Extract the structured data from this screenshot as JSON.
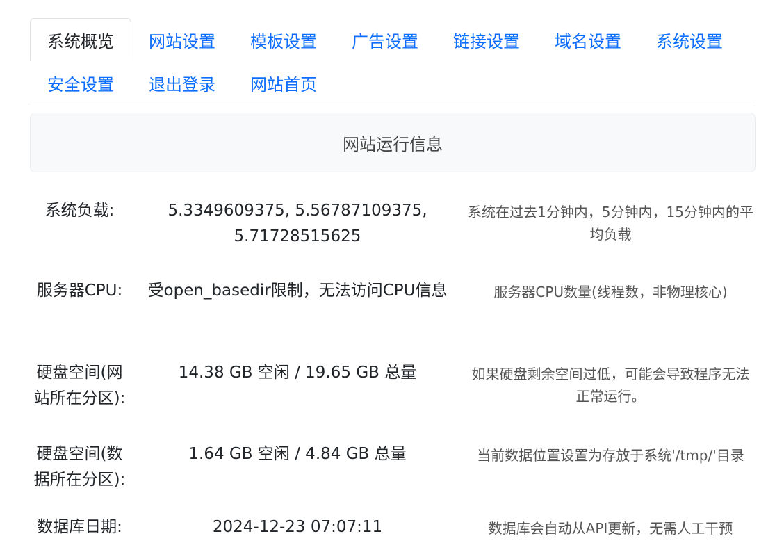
{
  "tabs": [
    {
      "label": "系统概览",
      "active": true
    },
    {
      "label": "网站设置",
      "active": false
    },
    {
      "label": "模板设置",
      "active": false
    },
    {
      "label": "广告设置",
      "active": false
    },
    {
      "label": "链接设置",
      "active": false
    },
    {
      "label": "域名设置",
      "active": false
    },
    {
      "label": "系统设置",
      "active": false
    },
    {
      "label": "安全设置",
      "active": false
    },
    {
      "label": "退出登录",
      "active": false
    },
    {
      "label": "网站首页",
      "active": false
    }
  ],
  "info_title": "网站运行信息",
  "rows": [
    {
      "label": "系统负载:",
      "value": "5.3349609375, 5.56787109375, 5.71728515625",
      "desc": "系统在过去1分钟内，5分钟内，15分钟内的平均负载"
    },
    {
      "label": "服务器CPU:",
      "value": "受open_basedir限制，无法访问CPU信息",
      "desc": "服务器CPU数量(线程数，非物理核心)"
    },
    {
      "label": "硬盘空间(网站所在分区):",
      "value": "14.38 GB 空闲 / 19.65 GB 总量",
      "desc": "如果硬盘剩余空间过低，可能会导致程序无法正常运行。"
    },
    {
      "label": "硬盘空间(数据所在分区):",
      "value": "1.64 GB 空闲 / 4.84 GB 总量",
      "desc": "当前数据位置设置为存放于系统'/tmp/'目录"
    },
    {
      "label": "数据库日期:",
      "value": "2024-12-23 07:07:11",
      "desc": "数据库会自动从API更新，无需人工干预"
    }
  ]
}
